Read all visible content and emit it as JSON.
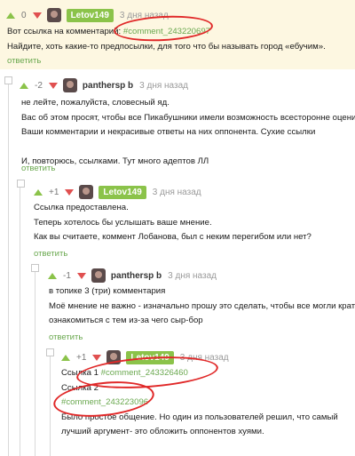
{
  "comments": [
    {
      "rating": "0",
      "author": "Letov149",
      "date": "3 дня назад",
      "lines": [
        {
          "pre": "Вот ссылка на комментарий: ",
          "link": "#comment_243220697"
        },
        {
          "text": "Найдите, хоть какие-то предпосылки, для того что бы называть город «ебучим»."
        }
      ],
      "reply": "ответить"
    },
    {
      "rating": "-2",
      "author": "panthersp b",
      "date": "3 дня назад",
      "lines": [
        {
          "text": "не лейте, пожалуйста, словесный яд."
        },
        {
          "text": "Вас об этом просят, чтобы все Пикабушники имели возможность всесторонне оценить"
        },
        {
          "text": "Ваши комментарии и некрасивые ответы на них оппонента. Сухие ссылки"
        },
        {
          "text": ""
        },
        {
          "text": "И, повторюсь, ссылками. Тут много адептов ЛЛ"
        }
      ],
      "reply": "ответить"
    },
    {
      "rating": "+1",
      "author": "Letov149",
      "date": "3 дня назад",
      "lines": [
        {
          "text": "Ссылка предоставлена."
        },
        {
          "text": "Теперь хотелось бы услышать ваше мнение."
        },
        {
          "text": "Как вы считаете,  коммент Лобанова, был с неким перегибом или нет?"
        }
      ],
      "reply": "ответить"
    },
    {
      "rating": "-1",
      "author": "panthersp b",
      "date": "3 дня назад",
      "lines": [
        {
          "text": "в топике 3 (три) комментария"
        },
        {
          "text": "Моё мнение не важно - изначально прошу это сделать, чтобы все могли кратко"
        },
        {
          "text": "ознакомиться с тем из-за чего сыр-бор"
        }
      ],
      "reply": "ответить"
    },
    {
      "rating": "+1",
      "author": "Letov149",
      "date": "3 дня назад",
      "lines": [
        {
          "pre": "Ссылка 1 ",
          "link": "#comment_243326460"
        },
        {
          "text": "Ссылка 2"
        },
        {
          "link": "#comment_243223096"
        },
        {
          "text": "Было простое общение. Но один из пользователей решил, что самый"
        },
        {
          "text": "лучший аргумент- это обложить оппонентов хуями."
        }
      ]
    }
  ]
}
